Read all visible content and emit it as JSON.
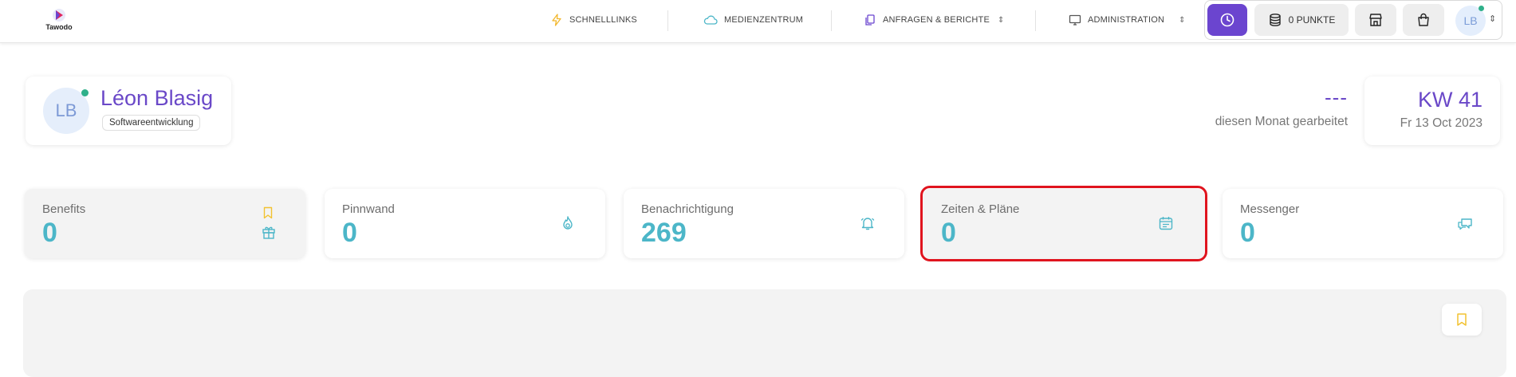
{
  "app": {
    "logo_text": "Tawodo"
  },
  "nav": {
    "quicklinks": "SCHNELLLINKS",
    "media": "MEDIENZENTRUM",
    "requests": "ANFRAGEN & BERICHTE",
    "admin": "ADMINISTRATION"
  },
  "actions": {
    "points_label": "0 PUNKTE",
    "avatar_initials": "LB",
    "clock_icon": "clock-icon",
    "points_icon": "database-icon",
    "store_icon": "store-icon",
    "cart_icon": "shopping-bag-icon"
  },
  "profile": {
    "initials": "LB",
    "name": "Léon Blasig",
    "department": "Softwareentwicklung",
    "status": "online"
  },
  "worked": {
    "value": "---",
    "label": "diesen Monat gearbeitet"
  },
  "week": {
    "title": "KW 41",
    "date": "Fr 13 Oct 2023"
  },
  "stats": [
    {
      "label": "Benefits",
      "value": "0",
      "icon": "gift-icon"
    },
    {
      "label": "Pinnwand",
      "value": "0",
      "icon": "flame-icon"
    },
    {
      "label": "Benachrichtigung",
      "value": "269",
      "icon": "bell-icon"
    },
    {
      "label": "Zeiten & Pläne",
      "value": "0",
      "icon": "calendar-icon"
    },
    {
      "label": "Messenger",
      "value": "0",
      "icon": "chat-icon"
    }
  ],
  "colors": {
    "brand_purple": "#6b45cf",
    "stat_teal": "#4cb6c8",
    "bookmark_yellow": "#f2c230",
    "highlight_red": "#e0141e",
    "online_green": "#2fb08a"
  }
}
